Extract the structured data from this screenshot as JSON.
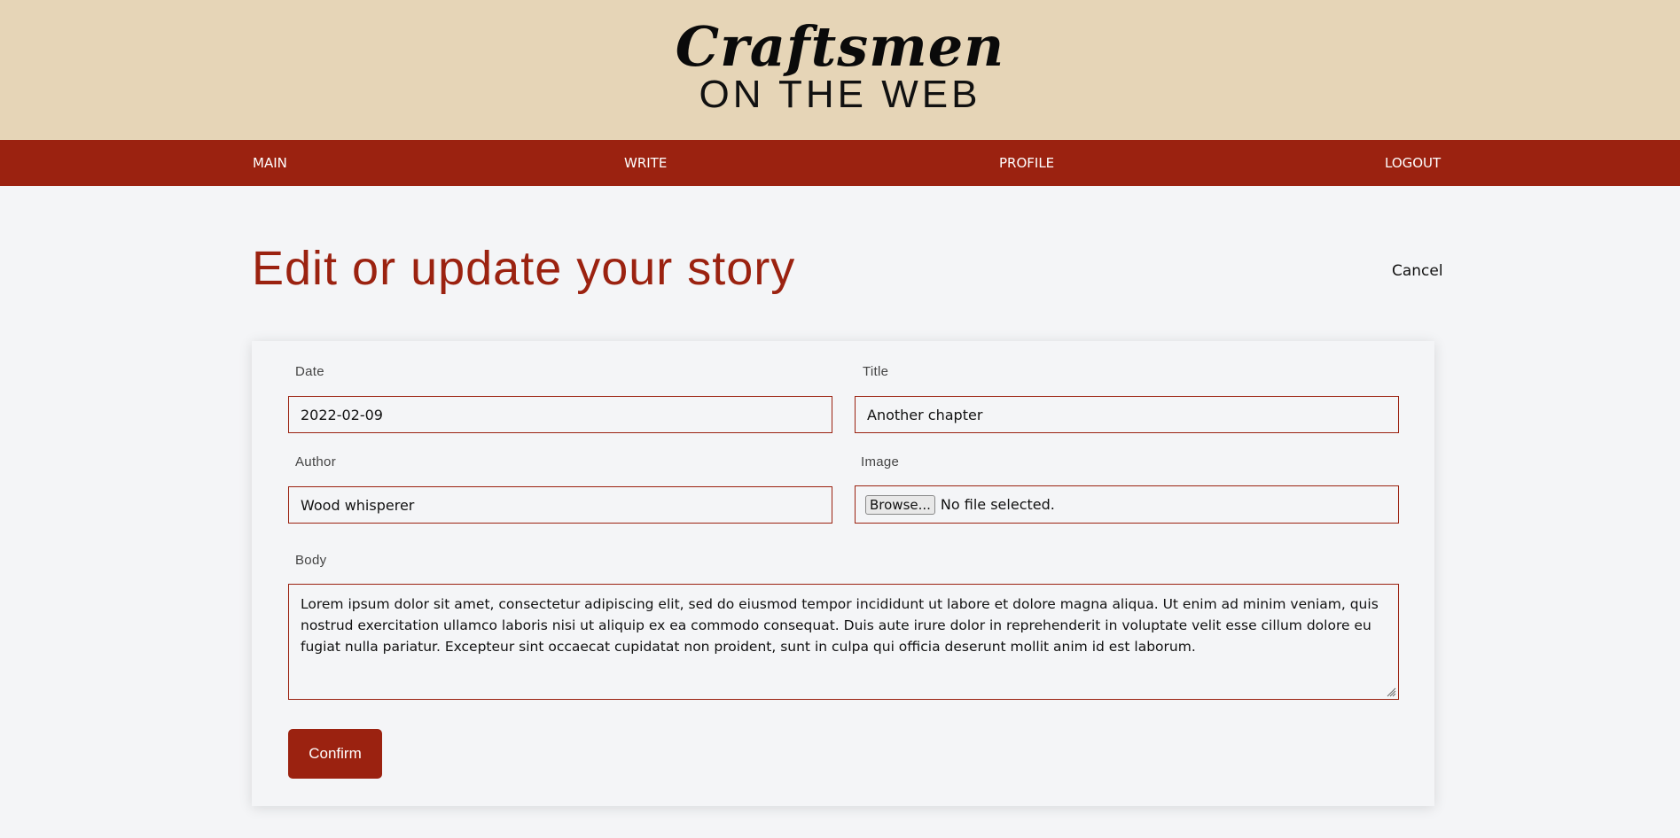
{
  "logo": {
    "main": "Craftsmen",
    "sub": "ON THE WEB"
  },
  "nav": {
    "main": "MAIN",
    "write": "WRITE",
    "profile": "PROFILE",
    "logout": "LOGOUT"
  },
  "page": {
    "title": "Edit or update your story",
    "cancel": "Cancel"
  },
  "form": {
    "date_label": "Date",
    "date_value": "2022-02-09",
    "title_label": "Title",
    "title_value": "Another chapter",
    "author_label": "Author",
    "author_value": "Wood whisperer",
    "image_label": "Image",
    "browse_label": "Browse...",
    "file_status": "No file selected.",
    "body_label": "Body",
    "body_value": "Lorem ipsum dolor sit amet, consectetur adipiscing elit, sed do eiusmod tempor incididunt ut labore et dolore magna aliqua. Ut enim ad minim veniam, quis nostrud exercitation ullamco laboris nisi ut aliquip ex ea commodo consequat. Duis aute irure dolor in reprehenderit in voluptate velit esse cillum dolore eu fugiat nulla pariatur. Excepteur sint occaecat cupidatat non proident, sunt in culpa qui officia deserunt mollit anim id est laborum.",
    "confirm_label": "Confirm"
  },
  "colors": {
    "header_bg": "#e6d5b7",
    "accent": "#9b2210",
    "page_bg": "#f4f5f7"
  }
}
